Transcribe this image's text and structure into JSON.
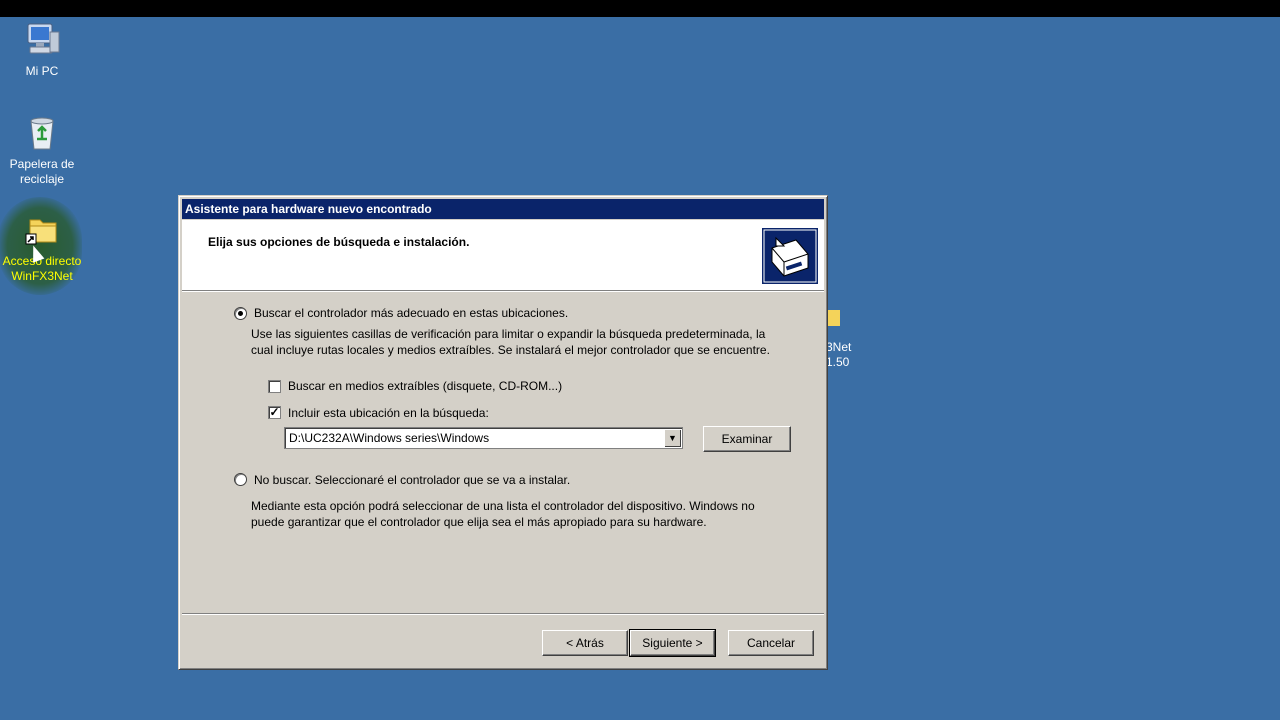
{
  "desktop": {
    "icons": [
      {
        "label": "Mi PC"
      },
      {
        "label": "Papelera de reciclaje"
      },
      {
        "label": "Acceso directo WinFX3Net"
      }
    ],
    "partial_icon": {
      "line1": "3Net",
      "line2": "1.50"
    }
  },
  "dialog": {
    "title": "Asistente para hardware nuevo encontrado",
    "header_title": "Elija sus opciones de búsqueda e instalación.",
    "option_search": {
      "label": "Buscar el controlador más adecuado en estas ubicaciones.",
      "selected": true,
      "description_line1": "Use las siguientes casillas de verificación para limitar o expandir la búsqueda predeterminada, la",
      "description_line2": "cual incluye rutas locales y medios extraíbles. Se instalará el mejor controlador que se encuentre."
    },
    "checkbox_removable": {
      "label": "Buscar en medios extraíbles (disquete, CD-ROM...)",
      "checked": false
    },
    "checkbox_location": {
      "label": "Incluir esta ubicación en la búsqueda:",
      "checked": true
    },
    "location_value": "D:\\UC232A\\Windows series\\Windows",
    "browse_label": "Examinar",
    "option_nosearch": {
      "label": "No buscar. Seleccionaré el controlador que se va a instalar.",
      "selected": false,
      "description_line1": "Mediante esta opción podrá seleccionar de una lista el controlador del dispositivo. Windows no",
      "description_line2": "puede garantizar que el controlador que elija sea el más apropiado para su hardware."
    },
    "buttons": {
      "back": "< Atrás",
      "next": "Siguiente >",
      "cancel": "Cancelar"
    }
  },
  "colors": {
    "desktop": "#3a6ea5",
    "titlebar": "#0a246a",
    "dialog_face": "#d4d0c8"
  }
}
